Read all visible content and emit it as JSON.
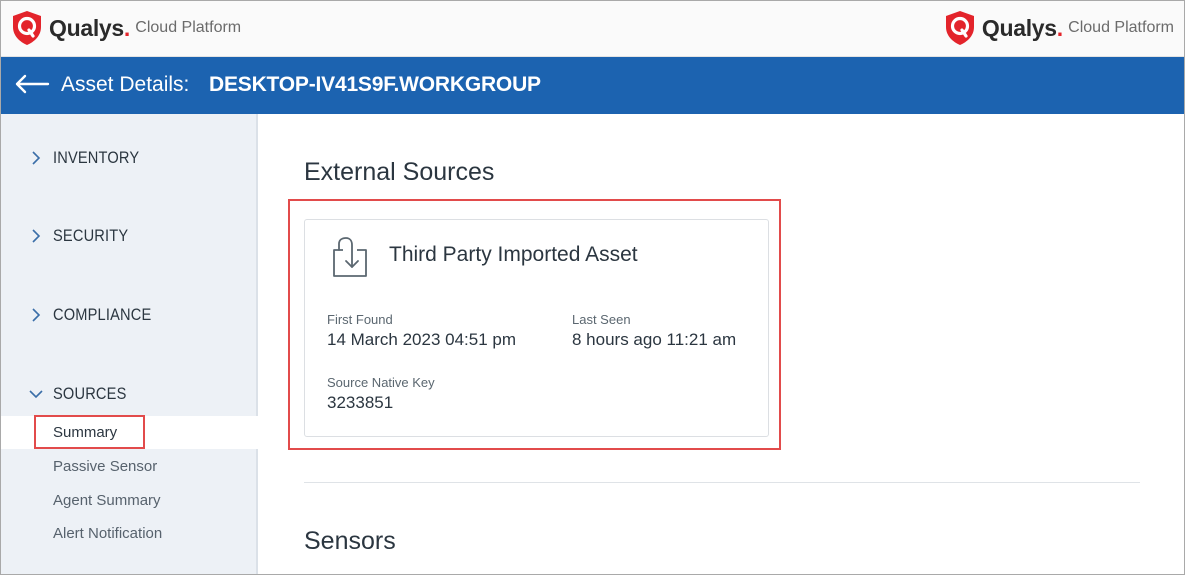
{
  "brand": {
    "name": "Qualys",
    "dot": ".",
    "product": "Cloud Platform",
    "accent": "#e3242b"
  },
  "header": {
    "label": "Asset Details:",
    "host": "DESKTOP-IV41S9F.WORKGROUP",
    "color": "#1c63b0"
  },
  "sidebar": {
    "sections": [
      {
        "label": "INVENTORY",
        "expanded": false
      },
      {
        "label": "SECURITY",
        "expanded": false
      },
      {
        "label": "COMPLIANCE",
        "expanded": false
      },
      {
        "label": "SOURCES",
        "expanded": true
      }
    ],
    "sub_items": [
      {
        "label": "Summary",
        "active": true
      },
      {
        "label": "Passive Sensor",
        "active": false
      },
      {
        "label": "Agent Summary",
        "active": false
      },
      {
        "label": "Alert Notification",
        "active": false
      }
    ]
  },
  "main": {
    "external_sources_title": "External Sources",
    "card": {
      "icon": "import-icon",
      "title": "Third Party Imported Asset",
      "first_found_label": "First Found",
      "first_found_value": "14 March 2023 04:51 pm",
      "last_seen_label": "Last Seen",
      "last_seen_value": "8 hours ago 11:21 am",
      "native_key_label": "Source Native Key",
      "native_key_value": "3233851"
    },
    "sensors_title": "Sensors"
  }
}
